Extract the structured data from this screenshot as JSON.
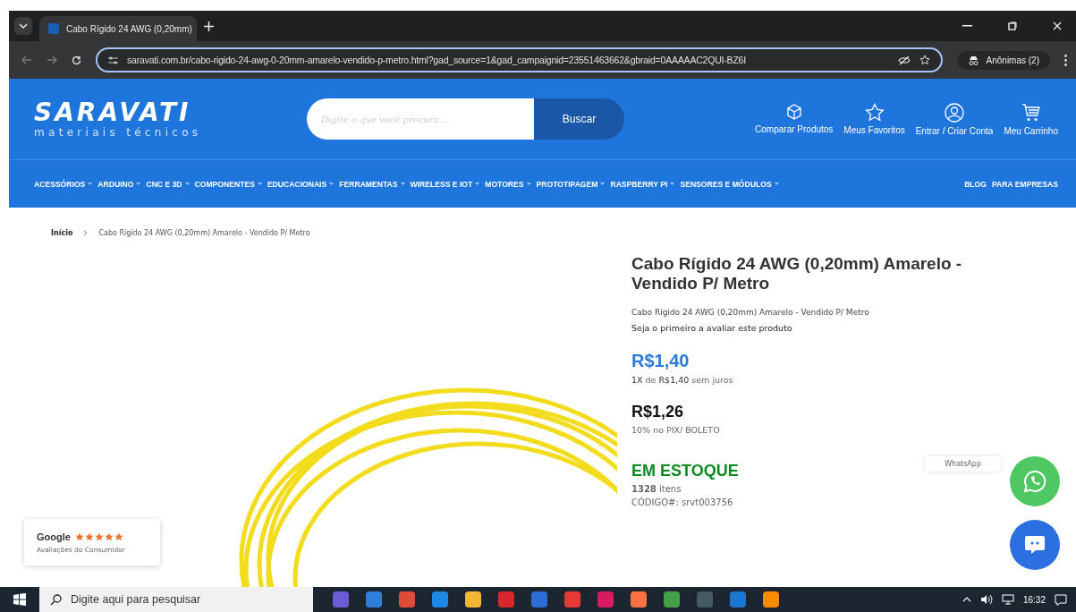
{
  "browser": {
    "tab_title": "Cabo Rígido 24 AWG (0,20mm)",
    "url": "saravati.com.br/cabo-rigido-24-awg-0-20mm-amarelo-vendido-p-metro.html?gad_source=1&gad_campaignid=23551463662&gbraid=0AAAAAC2QUI-BZ6I",
    "profile": "Anônimas (2)"
  },
  "header": {
    "logo": "SARAVATI",
    "tagline": "materiais técnicos",
    "search": {
      "placeholder": "Digite o que você procura...",
      "button": "Buscar"
    },
    "actions": [
      {
        "label": "Comparar Produtos",
        "kind": "compare"
      },
      {
        "label": "Meus Favoritos",
        "kind": "star"
      },
      {
        "label": "Entrar / Criar Conta",
        "kind": "user"
      },
      {
        "label": "Meu Carrinho",
        "kind": "cart"
      }
    ]
  },
  "nav": {
    "items": [
      {
        "label": "ACESSÓRIOS",
        "dropdown": true
      },
      {
        "label": "ARDUINO",
        "dropdown": true
      },
      {
        "label": "CNC E 3D",
        "dropdown": true
      },
      {
        "label": "COMPONENTES",
        "dropdown": true
      },
      {
        "label": "EDUCACIONAIS",
        "dropdown": true
      },
      {
        "label": "FERRAMENTAS",
        "dropdown": true
      },
      {
        "label": "WIRELESS E IOT",
        "dropdown": true
      },
      {
        "label": "MOTORES",
        "dropdown": true
      },
      {
        "label": "PROTOTIPAGEM",
        "dropdown": true
      },
      {
        "label": "RASPBERRY PI",
        "dropdown": true
      },
      {
        "label": "SENSORES E MÓDULOS",
        "dropdown": true
      }
    ],
    "right": [
      {
        "label": "BLOG",
        "dropdown": false
      },
      {
        "label": "PARA EMPRESAS",
        "dropdown": false
      }
    ]
  },
  "breadcrumb": [
    "Início",
    "Cabo Rígido 24 AWG (0,20mm) Amarelo - Vendido P/ Metro"
  ],
  "product": {
    "title": "Cabo Rígido 24 AWG (0,20mm) Amarelo - Vendido P/ Metro",
    "subtitle": "Cabo Rígido 24 AWG (0,20mm) Amarelo - Vendido P/ Metro",
    "review_prompt": "Seja o primeiro a avaliar este produto",
    "price": "R$1,40",
    "installments": "**1X** de **R$1,40** sem juros",
    "pix_price": "R$1,26",
    "pix_note": "10% no PIX/ BOLETO",
    "stock": "EM ESTOQUE",
    "quantity": "**1328** itens",
    "code": "CÓDIGO#:  srvt003756"
  },
  "google_badge": {
    "brand": "Google",
    "stars": 5,
    "caption": "Avaliações do Consumidor"
  },
  "whatsapp": {
    "label": "WhatsApp"
  },
  "taskbar": {
    "search_placeholder": "Digite aqui para pesquisar",
    "apps": [
      {
        "color": "#6b5cd6"
      },
      {
        "color": "#2f7fd8"
      },
      {
        "color": "#e04a3a"
      },
      {
        "color": "#1e88e5"
      },
      {
        "color": "#f2b632"
      },
      {
        "color": "#d9262c"
      },
      {
        "color": "#2b6fd6"
      },
      {
        "color": "#e53935"
      },
      {
        "color": "#d81b60"
      },
      {
        "color": "#ff7043"
      },
      {
        "color": "#43a047"
      },
      {
        "color": "#455a64"
      },
      {
        "color": "#1976d2"
      },
      {
        "color": "#fb8c00"
      }
    ],
    "time": "16:32"
  }
}
